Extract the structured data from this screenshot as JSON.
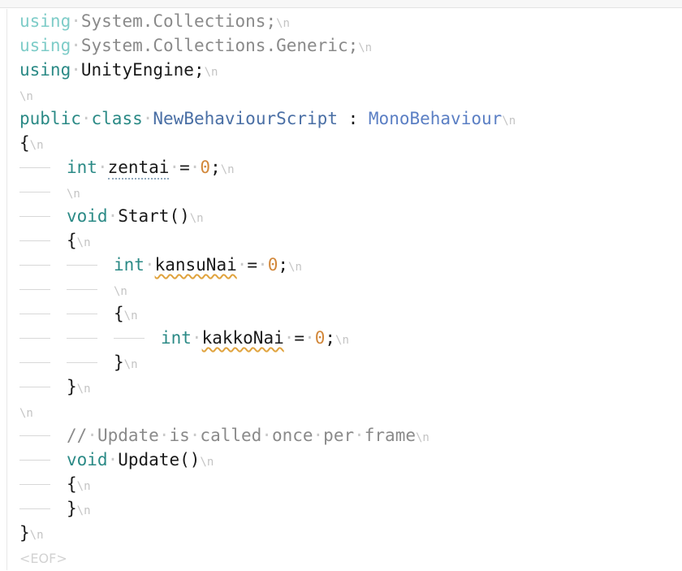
{
  "app": {
    "kind": "code-editor",
    "language": "csharp",
    "eof_marker": "<EOF>",
    "newline_marker": "\\n",
    "space_marker": "·"
  },
  "colors": {
    "background": "#ffffff",
    "top_rail": "#f7f7f7",
    "gutter_rule": "#e8e8e8",
    "keyword": "#2b8a86",
    "keyword_faded": "#7eccc8",
    "identifier": "#1a1a1a",
    "identifier_faded": "#8a8a8a",
    "type_name": "#4a6fa5",
    "base_type": "#5b7fc4",
    "number": "#d2883b",
    "comment": "#8a8a8a",
    "indent_guide": "#d8d8d8",
    "newline_marker": "#c4c4c4",
    "eof_marker": "#d2d2d2",
    "warning_squiggle": "#e0a33e",
    "info_dotted_underline": "#8fa8bd"
  },
  "document": {
    "lines": [
      {
        "n": 1,
        "indent": 0,
        "faded": true,
        "newline": true,
        "tokens": [
          {
            "t": "using",
            "c": "kw-faded"
          },
          {
            "t": "·",
            "c": "dot"
          },
          {
            "t": "System.Collections;",
            "c": "plain-faded"
          }
        ]
      },
      {
        "n": 2,
        "indent": 0,
        "faded": true,
        "newline": true,
        "tokens": [
          {
            "t": "using",
            "c": "kw-faded"
          },
          {
            "t": "·",
            "c": "dot"
          },
          {
            "t": "System.Collections.Generic;",
            "c": "plain-faded"
          }
        ]
      },
      {
        "n": 3,
        "indent": 0,
        "faded": false,
        "newline": true,
        "tokens": [
          {
            "t": "using",
            "c": "kw"
          },
          {
            "t": "·",
            "c": "dot"
          },
          {
            "t": "UnityEngine;",
            "c": "plain"
          }
        ]
      },
      {
        "n": 4,
        "indent": 0,
        "newline": true,
        "tokens": []
      },
      {
        "n": 5,
        "indent": 0,
        "newline": true,
        "tokens": [
          {
            "t": "public",
            "c": "kw"
          },
          {
            "t": "·",
            "c": "dot"
          },
          {
            "t": "class",
            "c": "kw"
          },
          {
            "t": "·",
            "c": "dot"
          },
          {
            "t": "NewBehaviourScript",
            "c": "type"
          },
          {
            "t": " : ",
            "c": "plain"
          },
          {
            "t": "MonoBehaviour",
            "c": "basetype"
          }
        ]
      },
      {
        "n": 6,
        "indent": 0,
        "newline": true,
        "tokens": [
          {
            "t": "{",
            "c": "plain"
          }
        ]
      },
      {
        "n": 7,
        "indent": 1,
        "newline": true,
        "tokens": [
          {
            "t": "int",
            "c": "kw"
          },
          {
            "t": "·",
            "c": "dot"
          },
          {
            "t": "zentai",
            "c": "plain",
            "underline": "dotted"
          },
          {
            "t": "·",
            "c": "dot"
          },
          {
            "t": "=",
            "c": "plain"
          },
          {
            "t": "·",
            "c": "dot"
          },
          {
            "t": "0",
            "c": "num"
          },
          {
            "t": ";",
            "c": "plain"
          }
        ]
      },
      {
        "n": 8,
        "indent": 1,
        "newline": true,
        "tokens": []
      },
      {
        "n": 9,
        "indent": 1,
        "newline": true,
        "tokens": [
          {
            "t": "void",
            "c": "kw"
          },
          {
            "t": "·",
            "c": "dot"
          },
          {
            "t": "Start()",
            "c": "plain"
          }
        ]
      },
      {
        "n": 10,
        "indent": 1,
        "newline": true,
        "tokens": [
          {
            "t": "{",
            "c": "plain"
          }
        ]
      },
      {
        "n": 11,
        "indent": 2,
        "newline": true,
        "tokens": [
          {
            "t": "int",
            "c": "kw"
          },
          {
            "t": "·",
            "c": "dot"
          },
          {
            "t": "kansuNai",
            "c": "plain",
            "underline": "wavy"
          },
          {
            "t": "·",
            "c": "dot"
          },
          {
            "t": "=",
            "c": "plain"
          },
          {
            "t": "·",
            "c": "dot"
          },
          {
            "t": "0",
            "c": "num"
          },
          {
            "t": ";",
            "c": "plain"
          }
        ]
      },
      {
        "n": 12,
        "indent": 2,
        "newline": true,
        "tokens": []
      },
      {
        "n": 13,
        "indent": 2,
        "newline": true,
        "tokens": [
          {
            "t": "{",
            "c": "plain"
          }
        ]
      },
      {
        "n": 14,
        "indent": 3,
        "newline": true,
        "tokens": [
          {
            "t": "int",
            "c": "kw"
          },
          {
            "t": "·",
            "c": "dot"
          },
          {
            "t": "kakkoNai",
            "c": "plain",
            "underline": "wavy"
          },
          {
            "t": "·",
            "c": "dot"
          },
          {
            "t": "=",
            "c": "plain"
          },
          {
            "t": "·",
            "c": "dot"
          },
          {
            "t": "0",
            "c": "num"
          },
          {
            "t": ";",
            "c": "plain"
          }
        ]
      },
      {
        "n": 15,
        "indent": 2,
        "newline": true,
        "tokens": [
          {
            "t": "}",
            "c": "plain"
          }
        ]
      },
      {
        "n": 16,
        "indent": 1,
        "newline": true,
        "tokens": [
          {
            "t": "}",
            "c": "plain"
          }
        ]
      },
      {
        "n": 17,
        "indent": 0,
        "newline": true,
        "tokens": []
      },
      {
        "n": 18,
        "indent": 1,
        "newline": true,
        "tokens": [
          {
            "t": "//",
            "c": "comment"
          },
          {
            "t": "·",
            "c": "dot"
          },
          {
            "t": "Update",
            "c": "comment"
          },
          {
            "t": "·",
            "c": "dot"
          },
          {
            "t": "is",
            "c": "comment"
          },
          {
            "t": "·",
            "c": "dot"
          },
          {
            "t": "called",
            "c": "comment"
          },
          {
            "t": "·",
            "c": "dot"
          },
          {
            "t": "once",
            "c": "comment"
          },
          {
            "t": "·",
            "c": "dot"
          },
          {
            "t": "per",
            "c": "comment"
          },
          {
            "t": "·",
            "c": "dot"
          },
          {
            "t": "frame",
            "c": "comment"
          }
        ]
      },
      {
        "n": 19,
        "indent": 1,
        "newline": true,
        "tokens": [
          {
            "t": "void",
            "c": "kw"
          },
          {
            "t": "·",
            "c": "dot"
          },
          {
            "t": "Update()",
            "c": "plain"
          }
        ]
      },
      {
        "n": 20,
        "indent": 1,
        "newline": true,
        "tokens": [
          {
            "t": "{",
            "c": "plain"
          }
        ]
      },
      {
        "n": 21,
        "indent": 1,
        "newline": true,
        "tokens": [
          {
            "t": "}",
            "c": "plain"
          }
        ]
      },
      {
        "n": 22,
        "indent": 0,
        "newline": true,
        "tokens": [
          {
            "t": "}",
            "c": "plain"
          }
        ]
      },
      {
        "n": 23,
        "indent": 0,
        "newline": false,
        "eof": true,
        "tokens": []
      }
    ]
  }
}
